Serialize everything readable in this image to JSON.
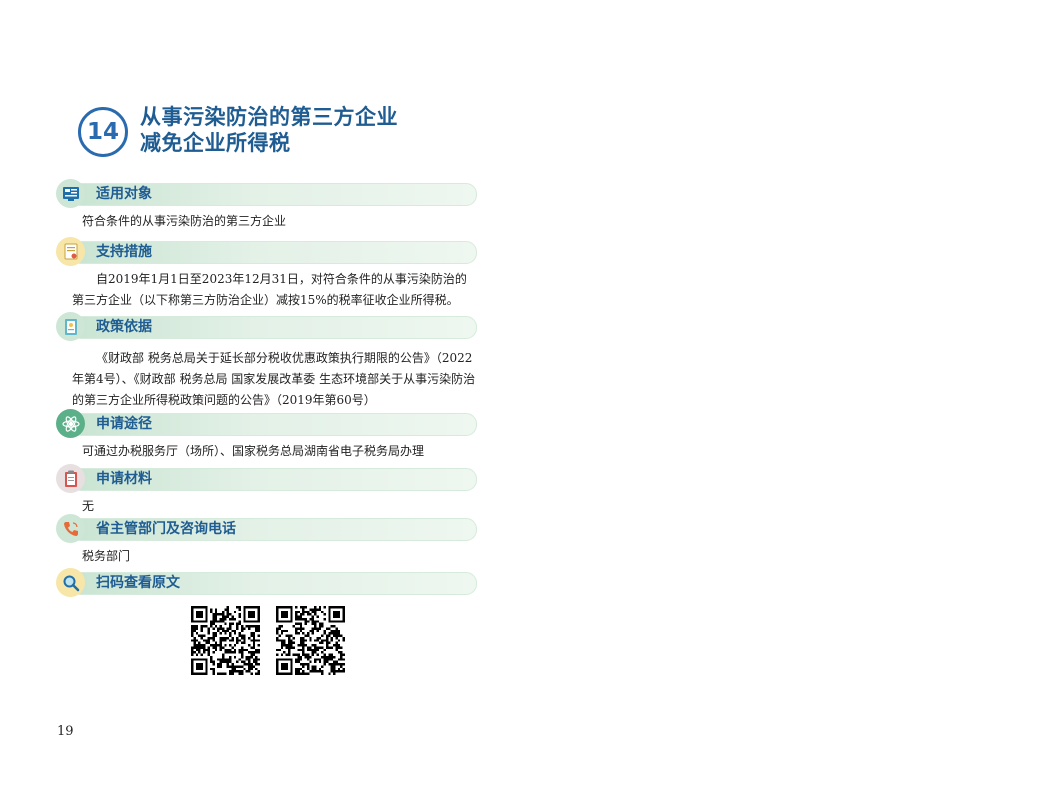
{
  "page": {
    "number_badge": "14",
    "title_lines": [
      "从事污染防治的第三方企业",
      "减免企业所得税"
    ],
    "page_number": "19"
  },
  "sections": [
    {
      "title": "适用对象",
      "icon": "document-card-icon",
      "icon_bg": "#cde6d6",
      "body": [
        "符合条件的从事污染防治的第三方企业"
      ]
    },
    {
      "title": "支持措施",
      "icon": "certificate-icon",
      "icon_bg": "#f7e6a8",
      "body": [
        "自2019年1月1日至2023年12月31日，对符合条件的从事污染防治的第三方企业（以下称第三方防治企业）减按15%的税率征收企业所得税。"
      ]
    },
    {
      "title": "政策依据",
      "icon": "policy-document-icon",
      "icon_bg": "#cde6d6",
      "body": [
        "《财政部 税务总局关于延长部分税收优惠政策执行期限的公告》（2022年第4号）、《财政部 税务总局 国家发展改革委 生态环境部关于从事污染防治的第三方企业所得税政策问题的公告》（2019年第60号）"
      ]
    },
    {
      "title": "申请途径",
      "icon": "atom-icon",
      "icon_bg": "#5bb08a",
      "body": [
        "可通过办税服务厅（场所）、国家税务总局湖南省电子税务局办理"
      ]
    },
    {
      "title": "申请材料",
      "icon": "clipboard-icon",
      "icon_bg": "#e8e0e0",
      "body": [
        "无"
      ]
    },
    {
      "title": "省主管部门及咨询电话",
      "icon": "phone-icon",
      "icon_bg": "#cde6d6",
      "body": [
        "税务部门"
      ]
    },
    {
      "title": "扫码查看原文",
      "icon": "magnifier-icon",
      "icon_bg": "#f7e6a8",
      "body": []
    }
  ],
  "qr_codes": [
    "qr-code-icon",
    "qr-code-icon"
  ],
  "colors": {
    "title_blue": "#1f5c92",
    "badge_blue": "#2a6bb0",
    "bar_green": "#c9e4d2"
  }
}
